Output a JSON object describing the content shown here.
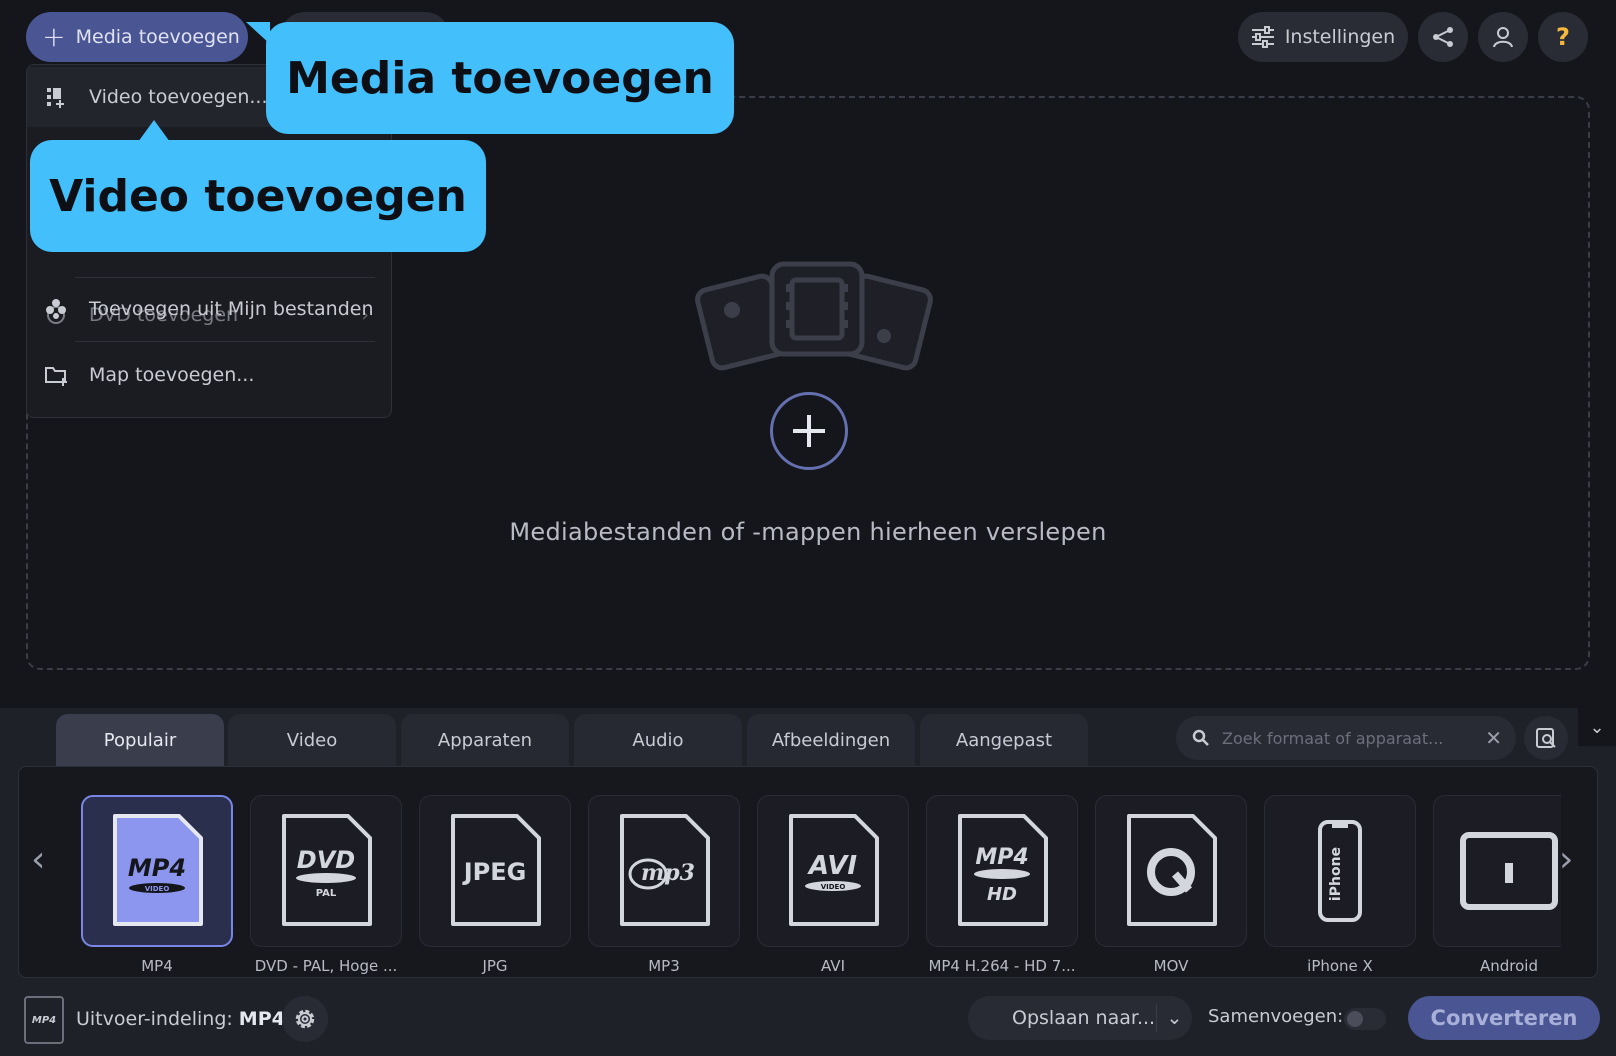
{
  "header": {
    "add_media_label": "Media toevoegen",
    "settings_label": "Instellingen"
  },
  "dropdown": {
    "items": [
      {
        "label": "Video toevoegen...",
        "icon": "video-add-icon"
      },
      {
        "label": "DVD toevoegen",
        "icon": "dvd-add-icon"
      },
      {
        "label": "Toevoegen uit Mijn bestanden",
        "icon": "my-files-icon"
      },
      {
        "label": "Map toevoegen...",
        "icon": "folder-add-icon"
      }
    ]
  },
  "callouts": {
    "media": "Media toevoegen",
    "video": "Video toevoegen"
  },
  "dropzone": {
    "text": "Mediabestanden of -mappen hierheen verslepen"
  },
  "tabs": [
    {
      "label": "Populair",
      "active": true
    },
    {
      "label": "Video",
      "active": false
    },
    {
      "label": "Apparaten",
      "active": false
    },
    {
      "label": "Audio",
      "active": false
    },
    {
      "label": "Afbeeldingen",
      "active": false
    },
    {
      "label": "Aangepast",
      "active": false
    }
  ],
  "search": {
    "placeholder": "Zoek formaat of apparaat..."
  },
  "formats": [
    {
      "label": "MP4",
      "icon_text": "MP4",
      "sub": "VIDEO",
      "active": true
    },
    {
      "label": "DVD - PAL, Hoge ...",
      "icon_text": "DVD",
      "sub": "PAL",
      "active": false
    },
    {
      "label": "JPG",
      "icon_text": "JPEG",
      "sub": "",
      "active": false
    },
    {
      "label": "MP3",
      "icon_text": "mp3",
      "sub": "",
      "active": false
    },
    {
      "label": "AVI",
      "icon_text": "AVI",
      "sub": "VIDEO",
      "active": false
    },
    {
      "label": "MP4 H.264 - HD 7...",
      "icon_text": "MP4",
      "sub": "HD",
      "active": false
    },
    {
      "label": "MOV",
      "icon_text": "Q",
      "sub": "",
      "active": false
    },
    {
      "label": "iPhone X",
      "icon_text": "iPhone",
      "sub": "",
      "active": false
    },
    {
      "label": "Android",
      "icon_text": "",
      "sub": "",
      "active": false
    }
  ],
  "footer": {
    "output_label": "Uitvoer-indeling:",
    "output_value": "MP4",
    "output_icon_text": "MP4",
    "save_label": "Opslaan naar...",
    "merge_label": "Samenvoegen:",
    "convert_label": "Converteren"
  },
  "colors": {
    "accent": "#4a5594",
    "callout": "#43bffb",
    "background": "#15161b"
  }
}
